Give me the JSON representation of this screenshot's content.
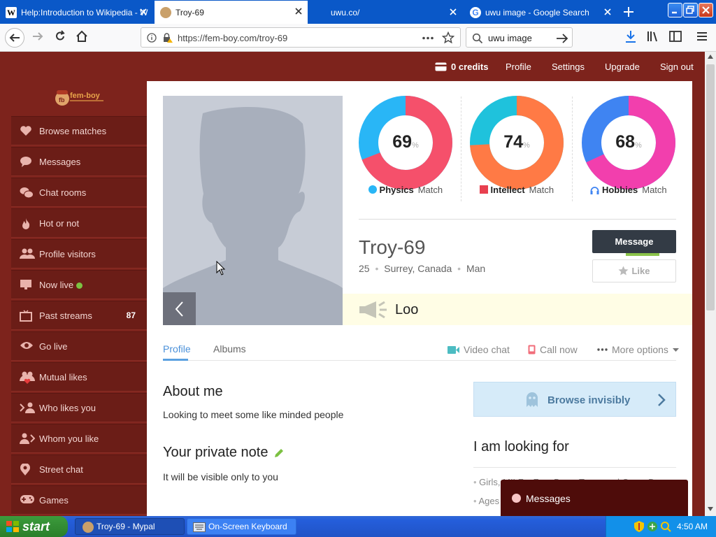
{
  "tabs": [
    {
      "title": "Help:Introduction to Wikipedia - W",
      "favicon": "wikipedia-icon"
    },
    {
      "title": "Troy-69",
      "favicon": "femboy-icon",
      "active": true
    },
    {
      "title": "uwu.co/",
      "favicon": "blank-page-icon"
    },
    {
      "title": "uwu image - Google Search",
      "favicon": "google-icon"
    }
  ],
  "browser": {
    "url": "https://fem-boy.com/troy-69",
    "search_value": "uwu image"
  },
  "topmenu": {
    "credits": "0 credits",
    "profile": "Profile",
    "settings": "Settings",
    "upgrade": "Upgrade",
    "signout": "Sign out"
  },
  "logo": {
    "text": "fem-boy"
  },
  "sidebar": {
    "items": [
      {
        "label": "Browse matches",
        "icon": "heart-icon"
      },
      {
        "label": "Messages",
        "icon": "speech-bubble-icon"
      },
      {
        "label": "Chat rooms",
        "icon": "chat-bubbles-icon"
      },
      {
        "label": "Hot or not",
        "icon": "flame-icon"
      },
      {
        "label": "Profile visitors",
        "icon": "people-icon"
      },
      {
        "label": "Now live",
        "icon": "monitor-icon",
        "live_dot": "#7cc142"
      },
      {
        "label": "Past streams",
        "icon": "tv-icon",
        "badge": "87"
      },
      {
        "label": "Go live",
        "icon": "eye-icon"
      },
      {
        "label": "Mutual likes",
        "icon": "mutual-heart-icon"
      },
      {
        "label": "Who likes you",
        "icon": "user-arrow-in-icon"
      },
      {
        "label": "Whom you like",
        "icon": "user-arrow-out-icon"
      },
      {
        "label": "Street chat",
        "icon": "map-pin-icon"
      },
      {
        "label": "Games",
        "icon": "gamepad-icon"
      }
    ]
  },
  "matches": [
    {
      "value": "69",
      "unit": "%",
      "label": "Physics",
      "suffix": "Match",
      "fraction": 0.69,
      "color_main": "#f5506b",
      "color_rest": "#29b6f6",
      "icon": "smiley-icon"
    },
    {
      "value": "74",
      "unit": "%",
      "label": "Intellect",
      "suffix": "Match",
      "fraction": 0.74,
      "color_main": "#ff7a45",
      "color_rest": "#1fc2dc",
      "icon": "book-icon"
    },
    {
      "value": "68",
      "unit": "%",
      "label": "Hobbies",
      "suffix": "Match",
      "fraction": 0.68,
      "color_main": "#f23fad",
      "color_rest": "#3f84f2",
      "icon": "headphones-icon"
    }
  ],
  "profile": {
    "name": "Troy-69",
    "age": "25",
    "location": "Surrey, Canada",
    "gender": "Man",
    "message_btn": "Message",
    "like_btn": "Like",
    "status": "Loo"
  },
  "profile_tabs": {
    "profile": "Profile",
    "albums": "Albums"
  },
  "actions": {
    "video": "Video chat",
    "call": "Call now",
    "more": "More options"
  },
  "about": {
    "title": "About me",
    "text": "Looking to meet some like minded people"
  },
  "note": {
    "title": "Your private note",
    "text": "It will be visible only to you"
  },
  "invisible": {
    "label": "Browse invisibly"
  },
  "looking": {
    "title": "I am looking for",
    "line1": "Girls, MILFs, Fem Boys, Trans and Cross Dressers",
    "line2": "Ages"
  },
  "message_popup": {
    "label": "Messages"
  },
  "taskbar": {
    "start": "start",
    "tasks": [
      {
        "label": "Troy-69 - Mypal",
        "icon": "mypal-icon"
      },
      {
        "label": "On-Screen Keyboard",
        "icon": "keyboard-icon"
      }
    ],
    "clock": "4:50 AM"
  }
}
